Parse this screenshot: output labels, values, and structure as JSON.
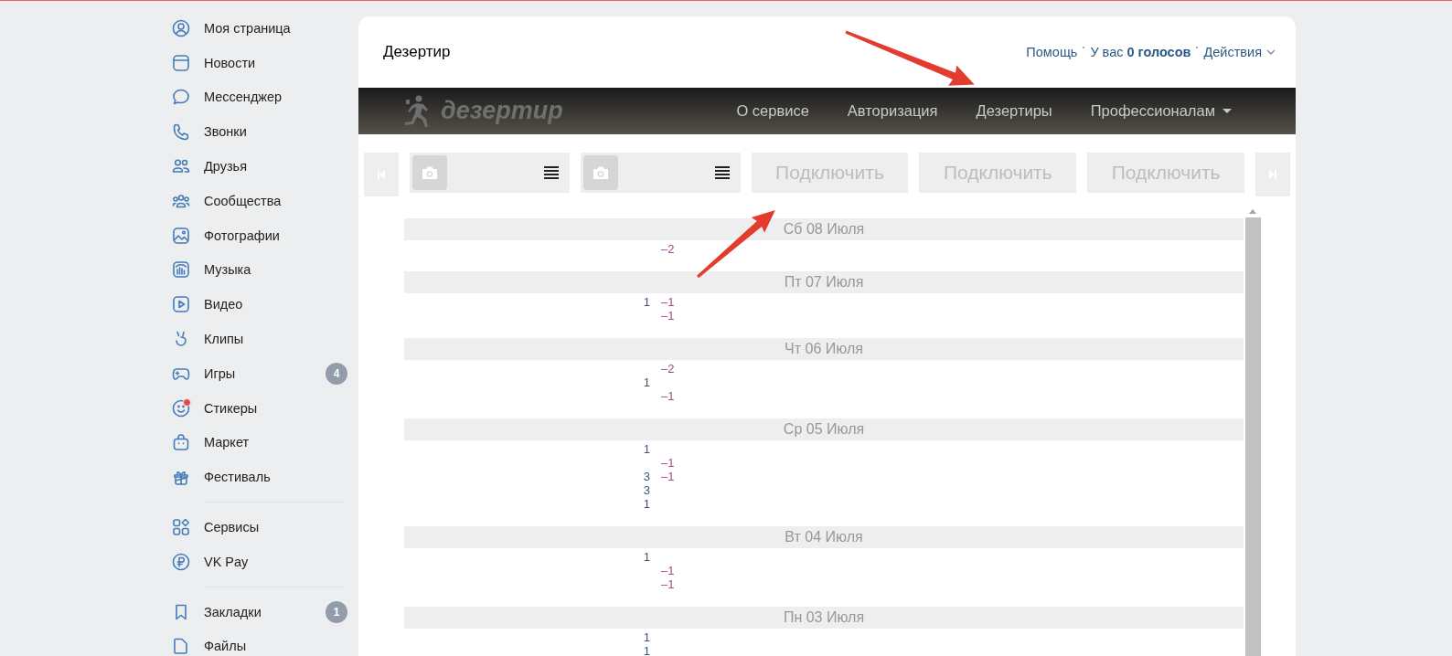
{
  "sidebar": {
    "groups": [
      [
        {
          "label": "Моя страница",
          "notification": false
        },
        {
          "label": "Новости",
          "notification": false
        },
        {
          "label": "Мессенджер",
          "notification": false
        },
        {
          "label": "Звонки",
          "notification": false
        },
        {
          "label": "Друзья",
          "notification": false
        },
        {
          "label": "Сообщества",
          "notification": false
        },
        {
          "label": "Фотографии",
          "notification": false
        },
        {
          "label": "Музыка",
          "notification": false
        },
        {
          "label": "Видео",
          "notification": false
        },
        {
          "label": "Клипы",
          "notification": false
        },
        {
          "label": "Игры",
          "notification": false,
          "badge": "4"
        },
        {
          "label": "Стикеры",
          "notification": true
        },
        {
          "label": "Маркет",
          "notification": false
        },
        {
          "label": "Фестиваль",
          "notification": false
        }
      ],
      [
        {
          "label": "Сервисы",
          "notification": false
        },
        {
          "label": "VK Pay",
          "notification": false
        }
      ],
      [
        {
          "label": "Закладки",
          "notification": false,
          "badge": "1"
        },
        {
          "label": "Файлы",
          "notification": false
        }
      ]
    ]
  },
  "app": {
    "title": "Дезертир",
    "header_links": [
      {
        "kind": "link",
        "text": "Помощь"
      },
      {
        "kind": "votes",
        "text": "У вас **0 голосов**"
      },
      {
        "kind": "menu",
        "text": "Действия"
      }
    ],
    "banner": {
      "logo_text": "дезертир",
      "nav": [
        {
          "label": "О сервисе",
          "dropdown": false
        },
        {
          "label": "Авторизация",
          "dropdown": false
        },
        {
          "label": "Дезертиры",
          "dropdown": false
        },
        {
          "label": "Профессионалам",
          "dropdown": true
        }
      ]
    },
    "toolbar": {
      "slots": [
        {
          "kind": "card"
        },
        {
          "kind": "card"
        },
        {
          "kind": "connect",
          "label": "Подключить",
          "disabled": true
        },
        {
          "kind": "connect",
          "label": "Подключить",
          "disabled": true
        },
        {
          "kind": "connect",
          "label": "Подключить",
          "disabled": true
        }
      ]
    },
    "days": [
      {
        "date": "Сб 08 Июля",
        "entries": [
          {
            "minus": "–2"
          }
        ]
      },
      {
        "date": "Пт 07 Июля",
        "entries": [
          {
            "plus": "1",
            "minus": "–1"
          },
          {
            "minus": "–1"
          }
        ]
      },
      {
        "date": "Чт 06 Июля",
        "entries": [
          {
            "minus": "–2"
          },
          {
            "plus": "1"
          },
          {
            "minus": "–1"
          }
        ]
      },
      {
        "date": "Ср 05 Июля",
        "entries": [
          {
            "plus": "1"
          },
          {
            "minus": "–1"
          },
          {
            "plus": "3",
            "minus": "–1"
          },
          {
            "plus": "3"
          },
          {
            "plus": "1"
          }
        ]
      },
      {
        "date": "Вт 04 Июля",
        "entries": [
          {
            "plus": "1"
          },
          {
            "minus": "–1"
          },
          {
            "minus": "–1"
          }
        ]
      },
      {
        "date": "Пн 03 Июля",
        "entries": [
          {
            "plus": "1"
          },
          {
            "plus": "1"
          }
        ]
      }
    ]
  }
}
